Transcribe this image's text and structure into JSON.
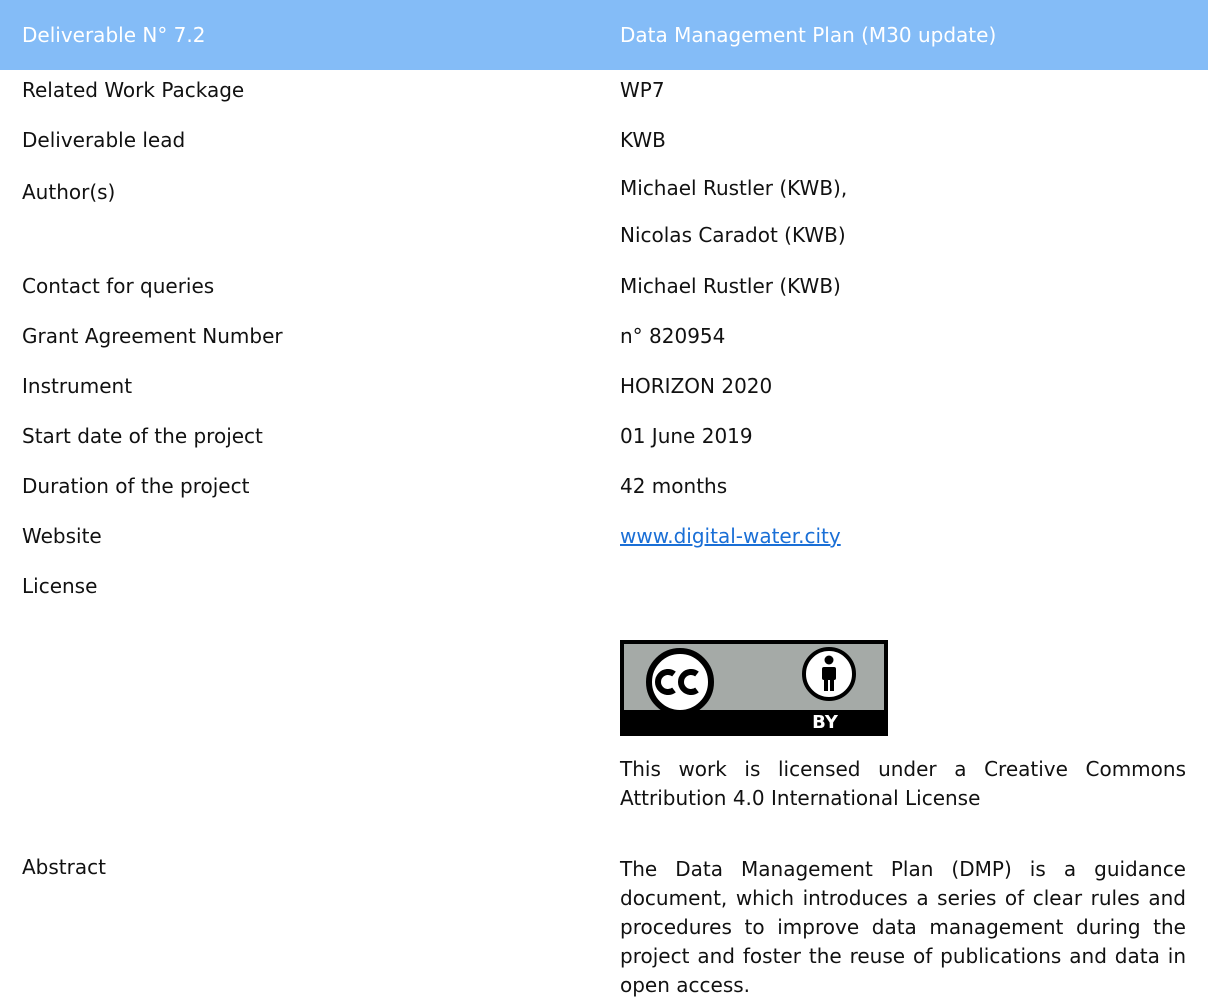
{
  "header": {
    "label": "Deliverable N° 7.2",
    "value": "Data Management Plan (M30 update)"
  },
  "rows": [
    {
      "label": "Related Work Package",
      "value": "WP7"
    },
    {
      "label": "Deliverable lead",
      "value": "KWB"
    },
    {
      "label": "Author(s)",
      "value": "Michael Rustler (KWB),",
      "value2": "Nicolas Caradot (KWB)"
    },
    {
      "label": "Contact for queries",
      "value": "Michael Rustler (KWB)"
    },
    {
      "label": "Grant Agreement Number",
      "value": "n° 820954"
    },
    {
      "label": "Instrument",
      "value": "HORIZON 2020"
    },
    {
      "label": "Start date of the project",
      "value": "01 June 2019"
    },
    {
      "label": "Duration of the project",
      "value": "42 months"
    },
    {
      "label": "Website",
      "value": "www.digital-water.city"
    },
    {
      "label": "License",
      "badge_text": "BY",
      "license_text": "This work is licensed under a Creative Commons Attribution 4.0 International License"
    },
    {
      "label": "Abstract",
      "value": "The Data Management Plan (DMP) is a guidance document, which introduces a series of clear rules and procedures to improve data management during the project and foster the reuse of publications and data in open access."
    }
  ],
  "colors": {
    "header_bg": "#84bcf7",
    "link": "#1a6fd6"
  },
  "icons": {
    "license_badge": "creative-commons-by-icon"
  }
}
